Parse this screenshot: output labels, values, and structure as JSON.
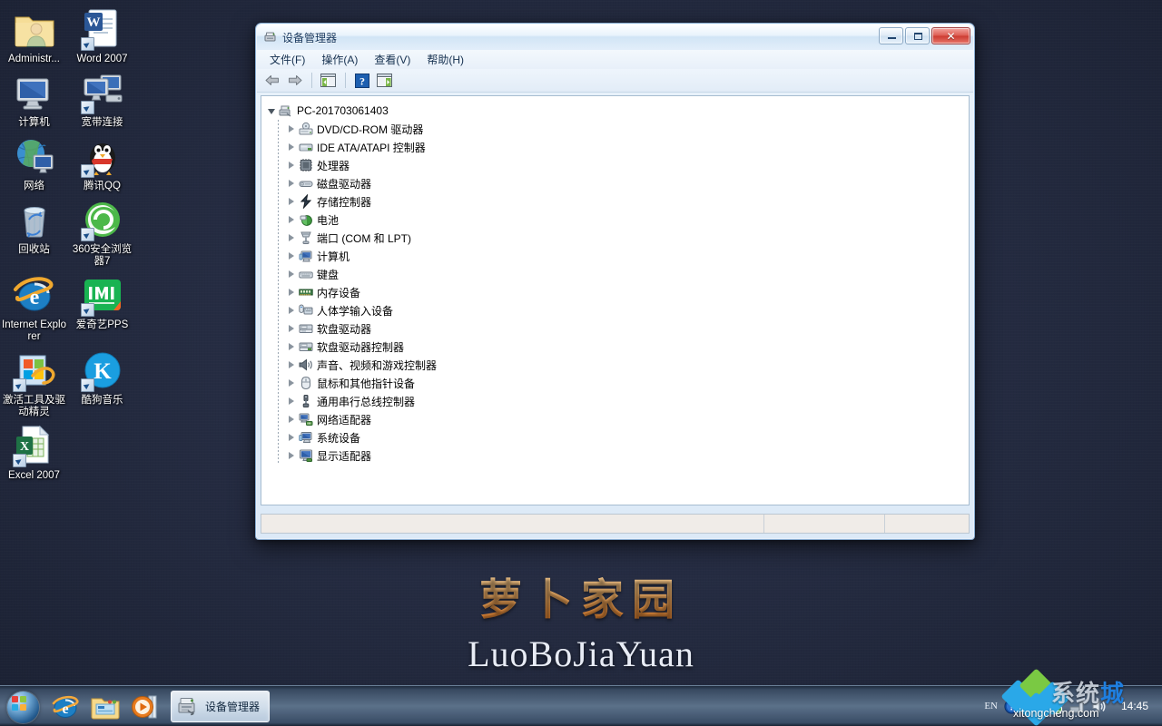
{
  "desktop": {
    "wallpaper": {
      "logo_cn": "萝卜家园",
      "logo_en": "LuoBoJiaYuan",
      "bg_color": "#252c42"
    },
    "icons": [
      {
        "label": "Administr...",
        "icon": "user-folder-icon",
        "shortcut": false
      },
      {
        "label": "Word 2007",
        "icon": "word-icon",
        "shortcut": true
      },
      {
        "label": "计算机",
        "icon": "computer-icon",
        "shortcut": false
      },
      {
        "label": "宽带连接",
        "icon": "broadband-connection-icon",
        "shortcut": true
      },
      {
        "label": "网络",
        "icon": "network-icon",
        "shortcut": false
      },
      {
        "label": "腾讯QQ",
        "icon": "qq-penguin-icon",
        "shortcut": true
      },
      {
        "label": "回收站",
        "icon": "recycle-bin-icon",
        "shortcut": false
      },
      {
        "label": "360安全浏览器7",
        "icon": "360-browser-icon",
        "shortcut": true
      },
      {
        "label": "Internet Explorer",
        "icon": "internet-explorer-icon",
        "shortcut": false
      },
      {
        "label": "爱奇艺PPS",
        "icon": "iqiyi-pps-icon",
        "shortcut": true
      },
      {
        "label": "激活工具及驱动精灵",
        "icon": "activation-tools-folder-icon",
        "shortcut": true
      },
      {
        "label": "酷狗音乐",
        "icon": "kugou-music-icon",
        "shortcut": true
      },
      {
        "label": "Excel 2007",
        "icon": "excel-icon",
        "shortcut": true
      }
    ]
  },
  "window": {
    "title": "设备管理器",
    "title_icon": "device-manager-icon",
    "buttons": {
      "minimize": "最小化",
      "maximize": "最大化",
      "close": "✕"
    },
    "menu": [
      {
        "label": "文件(F)",
        "name": "menu-file"
      },
      {
        "label": "操作(A)",
        "name": "menu-action"
      },
      {
        "label": "查看(V)",
        "name": "menu-view"
      },
      {
        "label": "帮助(H)",
        "name": "menu-help"
      }
    ],
    "toolbar": [
      {
        "name": "back-button",
        "icon": "arrow-left-icon",
        "label": "后退"
      },
      {
        "name": "forward-button",
        "icon": "arrow-right-icon",
        "label": "前进"
      },
      {
        "name": "show-hide-console-tree-button",
        "icon": "console-tree-icon",
        "label": "显示/隐藏控制台树"
      },
      {
        "name": "help-button",
        "icon": "help-question-icon",
        "label": "帮助"
      },
      {
        "name": "properties-button",
        "icon": "properties-panel-icon",
        "label": "属性"
      }
    ],
    "tree": {
      "root": {
        "label": "PC-201703061403",
        "icon": "computer-node-icon",
        "expanded": true
      },
      "items": [
        {
          "label": "DVD/CD-ROM 驱动器",
          "icon": "dvd-drive-icon"
        },
        {
          "label": "IDE ATA/ATAPI 控制器",
          "icon": "ide-controller-icon"
        },
        {
          "label": "处理器",
          "icon": "processor-icon"
        },
        {
          "label": "磁盘驱动器",
          "icon": "disk-drive-icon"
        },
        {
          "label": "存储控制器",
          "icon": "storage-controller-icon"
        },
        {
          "label": "电池",
          "icon": "battery-icon"
        },
        {
          "label": "端口 (COM 和 LPT)",
          "icon": "ports-icon"
        },
        {
          "label": "计算机",
          "icon": "computer-icon"
        },
        {
          "label": "键盘",
          "icon": "keyboard-icon"
        },
        {
          "label": "内存设备",
          "icon": "memory-device-icon"
        },
        {
          "label": "人体学输入设备",
          "icon": "hid-input-icon"
        },
        {
          "label": "软盘驱动器",
          "icon": "floppy-drive-icon"
        },
        {
          "label": "软盘驱动器控制器",
          "icon": "floppy-controller-icon"
        },
        {
          "label": "声音、视频和游戏控制器",
          "icon": "sound-video-game-icon"
        },
        {
          "label": "鼠标和其他指针设备",
          "icon": "mouse-icon"
        },
        {
          "label": "通用串行总线控制器",
          "icon": "usb-controller-icon"
        },
        {
          "label": "网络适配器",
          "icon": "network-adapter-icon"
        },
        {
          "label": "系统设备",
          "icon": "system-device-icon"
        },
        {
          "label": "显示适配器",
          "icon": "display-adapter-icon"
        }
      ]
    },
    "statusbar": {
      "pane1": "",
      "pane2": "",
      "pane3": ""
    }
  },
  "taskbar": {
    "start_label": "开始",
    "launchers": [
      {
        "name": "taskbar-ie",
        "icon": "internet-explorer-icon",
        "label": "Internet Explorer"
      },
      {
        "name": "taskbar-explorer",
        "icon": "folder-explorer-icon",
        "label": "Windows 资源管理器"
      },
      {
        "name": "taskbar-media-player",
        "icon": "media-player-icon",
        "label": "Windows Media Player"
      }
    ],
    "tasks": [
      {
        "name": "taskbar-task-device-manager",
        "label": "设备管理器",
        "icon": "device-manager-icon",
        "active": true
      }
    ],
    "tray": {
      "language": "EN",
      "icons": [
        {
          "name": "ime-help-icon",
          "label": "输入法帮助"
        },
        {
          "name": "show-hidden-icons-icon",
          "label": "显示隐藏的图标"
        },
        {
          "name": "security-shield-icon",
          "label": "操作中心"
        },
        {
          "name": "network-tray-icon",
          "label": "网络"
        },
        {
          "name": "volume-tray-icon",
          "label": "音量"
        }
      ],
      "clock": "14:45"
    }
  },
  "watermark": {
    "cn_dark": "系统",
    "cn_blue": "城",
    "url": "xitongcheng.com"
  }
}
